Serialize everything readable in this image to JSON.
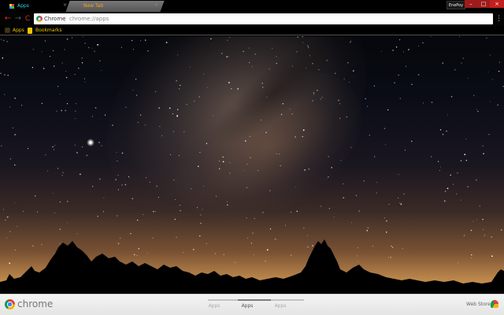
{
  "tabs": [
    {
      "title": "Apps"
    },
    {
      "title": "New Tab"
    }
  ],
  "window": {
    "profile_label": "EnePoy",
    "minimize": "–",
    "maximize": "□",
    "close": "×"
  },
  "toolbar": {
    "back": "←",
    "forward": "→",
    "reload": "C",
    "omnibox": {
      "site_label": "Chrome",
      "separator": "|",
      "url": "chrome://apps"
    },
    "star": "☆",
    "menu": "⋮"
  },
  "bookmarks_bar": {
    "items": [
      {
        "label": "Apps",
        "icon": "apps-grid-icon"
      },
      {
        "label": "Bookmarks",
        "icon": "folder-icon"
      }
    ]
  },
  "bottom_bar": {
    "brand": "chrome",
    "pages": [
      {
        "label": "Apps",
        "active": false
      },
      {
        "label": "Apps",
        "active": true
      },
      {
        "label": "Apps",
        "active": false
      }
    ],
    "web_store_label": "Web Store"
  },
  "colors": {
    "accent_red": "#c83030",
    "bookmark_yellow": "#f2c400",
    "tab_cyan": "#2ad4e6",
    "tab_orange": "#f6a21a"
  }
}
